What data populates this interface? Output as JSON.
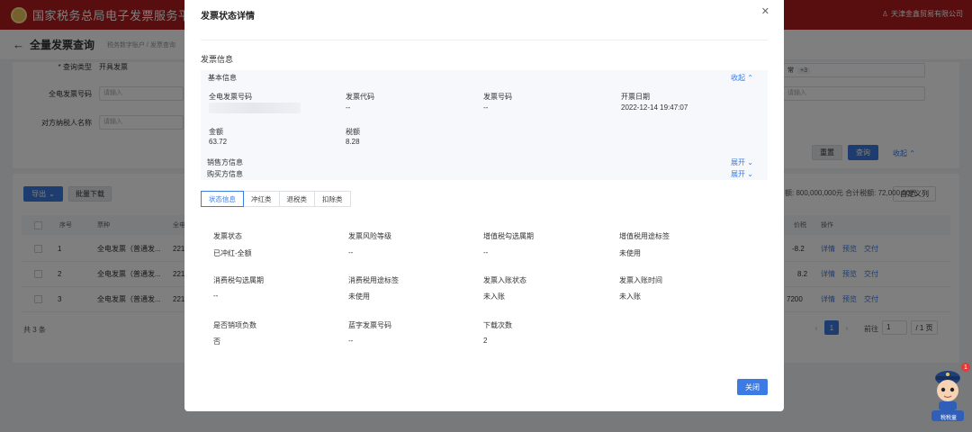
{
  "header": {
    "title": "国家税务总局电子发票服务平台",
    "user": "天津金鑫贸易有限公司"
  },
  "page": {
    "title": "全量发票查询",
    "breadcrumb": "税务数字账户  /  发票查询"
  },
  "filters": {
    "query_type_label": "* 查询类型",
    "query_type_value": "开具发票",
    "invoice_no_label": "全电发票号码",
    "invoice_no_placeholder": "请输入",
    "taxpayer_label": "对方纳税人名称",
    "taxpayer_placeholder": "请输入",
    "right_select_value": "常",
    "right_select_tag": "+3",
    "right_input_placeholder": "请输入",
    "reset_label": "重置",
    "query_label": "查询",
    "collapse_label": "收起"
  },
  "table": {
    "export_label": "导出",
    "batch_download_label": "批量下载",
    "custom_columns_label": "自定义列",
    "summary": "额: 800,000,000元  合计税额: 72,000.00元",
    "headers": [
      "序号",
      "票种",
      "全电",
      "价税",
      "操作"
    ],
    "rows": [
      {
        "no": "1",
        "type": "全电发票（普通发...",
        "code": "221",
        "amount": "-8.2"
      },
      {
        "no": "2",
        "type": "全电发票（普通发...",
        "code": "221",
        "amount": "8.2"
      },
      {
        "no": "3",
        "type": "全电发票（普通发...",
        "code": "221",
        "amount": "7200"
      }
    ],
    "actions": [
      "详情",
      "预览",
      "交付"
    ],
    "total_label": "共 3 条",
    "page_current": "1",
    "goto_label": "前往",
    "goto_value": "1",
    "page_total": "/ 1 页"
  },
  "modal": {
    "title": "发票状态详情",
    "close_icon": "close-icon",
    "section_title": "发票信息",
    "basic": {
      "title": "基本信息",
      "collapse_label": "收起",
      "fields": [
        {
          "label": "全电发票号码",
          "value": ""
        },
        {
          "label": "发票代码",
          "value": "--"
        },
        {
          "label": "发票号码",
          "value": "--"
        },
        {
          "label": "开票日期",
          "value": "2022-12-14 19:47:07"
        },
        {
          "label": "金额",
          "value": "63.72"
        },
        {
          "label": "税额",
          "value": "8.28"
        }
      ]
    },
    "seller_info_label": "销售方信息",
    "buyer_info_label": "购买方信息",
    "expand_label": "展开",
    "tabs": [
      "状态信息",
      "冲红类",
      "退税类",
      "扣除类"
    ],
    "status_fields": [
      {
        "label": "发票状态",
        "value": "已冲红-全额"
      },
      {
        "label": "发票风险等级",
        "value": "--"
      },
      {
        "label": "增值税勾选属期",
        "value": "--"
      },
      {
        "label": "增值税用途标签",
        "value": "未使用"
      },
      {
        "label": "消费税勾选属期",
        "value": "--"
      },
      {
        "label": "消费税用途标签",
        "value": "未使用"
      },
      {
        "label": "发票入账状态",
        "value": "未入账"
      },
      {
        "label": "发票入账时间",
        "value": "未入账"
      },
      {
        "label": "是否销项负数",
        "value": "否"
      },
      {
        "label": "蓝字发票号码",
        "value": "--"
      },
      {
        "label": "下载次数",
        "value": "2"
      }
    ],
    "ok_label": "关闭"
  },
  "mascot": {
    "badge": "1",
    "label": "税税童"
  },
  "colors": {
    "brand": "#b11a1c",
    "primary": "#3b7be3"
  }
}
